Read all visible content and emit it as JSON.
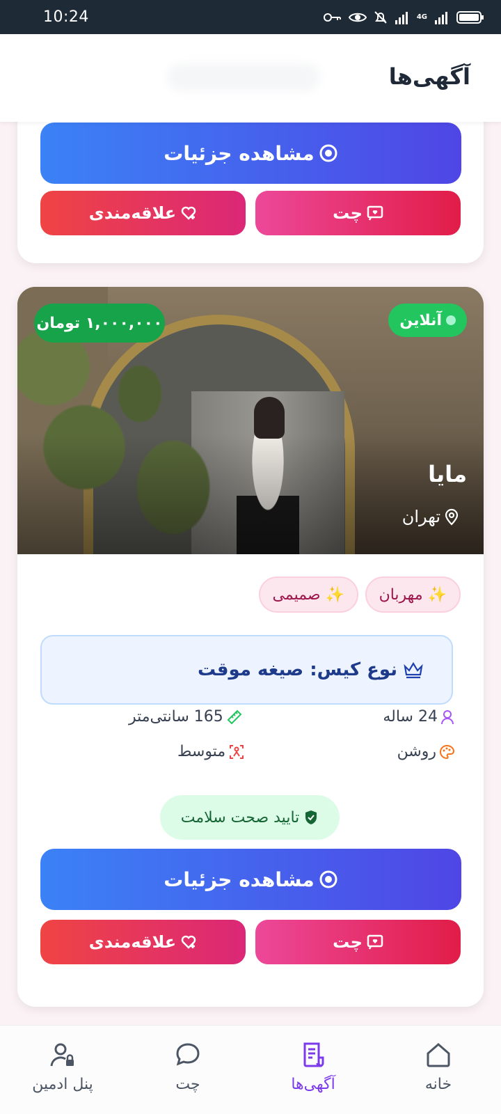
{
  "status_bar": {
    "time": "10:24",
    "network": "4G"
  },
  "header": {
    "title": "آگهی‌ها"
  },
  "top_card": {
    "details_label": "مشاهده جزئیات",
    "chat_label": "چت",
    "fav_label": "علاقه‌مندی"
  },
  "listing": {
    "status": "آنلاین",
    "price": "۱,۰۰۰,۰۰۰ تومان",
    "name": "مایا",
    "city": "تهران",
    "tags": [
      "✨ مهربان",
      "✨ صمیمی"
    ],
    "case_type": "نوع کیس: صیغه موقت",
    "age": "24 ساله",
    "height": "165 سانتی‌متر",
    "skin": "روشن",
    "body": "متوسط",
    "health": "تایید صحت سلامت",
    "details_label": "مشاهده جزئیات",
    "chat_label": "چت",
    "fav_label": "علاقه‌مندی"
  },
  "bottom_nav": {
    "items": [
      {
        "label": "پنل ادمین",
        "icon": "user-lock-icon"
      },
      {
        "label": "چت",
        "icon": "chat-bubble-icon"
      },
      {
        "label": "آگهی‌ها",
        "icon": "document-icon",
        "active": true
      },
      {
        "label": "خانه",
        "icon": "home-icon"
      }
    ]
  },
  "colors": {
    "accent": "#7c3aed",
    "details_gradient": [
      "#3b82f6",
      "#4f46e5"
    ],
    "chat_gradient": [
      "#ec4899",
      "#e11d48"
    ],
    "fav_gradient": [
      "#ef4444",
      "#db2777"
    ],
    "online": "#22c55e"
  }
}
